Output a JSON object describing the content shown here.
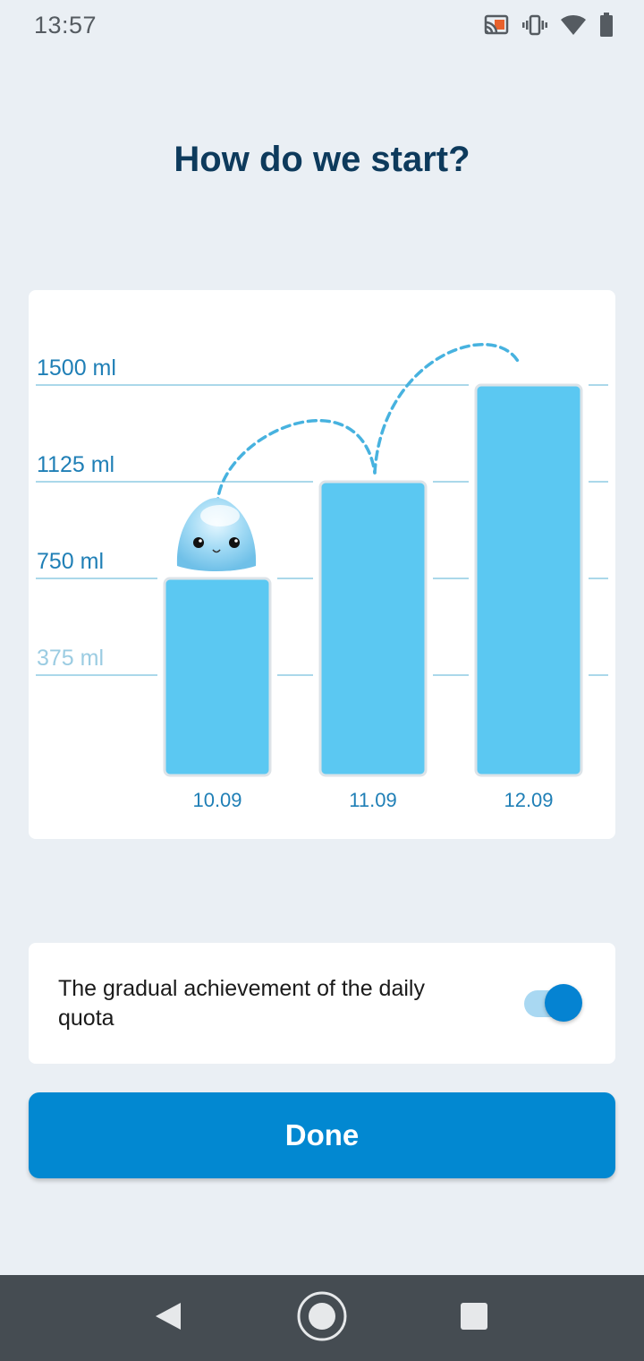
{
  "status_bar": {
    "time": "13:57",
    "icons": [
      "cast-icon",
      "vibrate-icon",
      "wifi-icon",
      "battery-icon"
    ]
  },
  "title": "How do we start?",
  "chart_data": {
    "type": "bar",
    "categories": [
      "10.09",
      "11.09",
      "12.09"
    ],
    "values": [
      750,
      1125,
      1500
    ],
    "unit": "ml",
    "yticks": [
      375,
      750,
      1125,
      1500
    ],
    "ytick_labels": [
      "375 ml",
      "750 ml",
      "1125 ml",
      "1500 ml"
    ],
    "ylim": [
      0,
      1500
    ],
    "grid": true,
    "colors": {
      "bar": "#5BC8F2",
      "bar_border": "#DCE3E8",
      "gridline": "#8FCBE3",
      "label_strong": "#1F7FB6",
      "label_faint": "#9BCCE2",
      "x_label": "#1F7FB6",
      "jump_path": "#47B2DF"
    },
    "mascot": "water-drop-mascot"
  },
  "setting": {
    "label": "The gradual achievement of the daily quota",
    "enabled": true
  },
  "done_button": {
    "label": "Done"
  },
  "nav_bar": {
    "buttons": [
      "back-icon",
      "home-icon",
      "recents-icon"
    ]
  }
}
